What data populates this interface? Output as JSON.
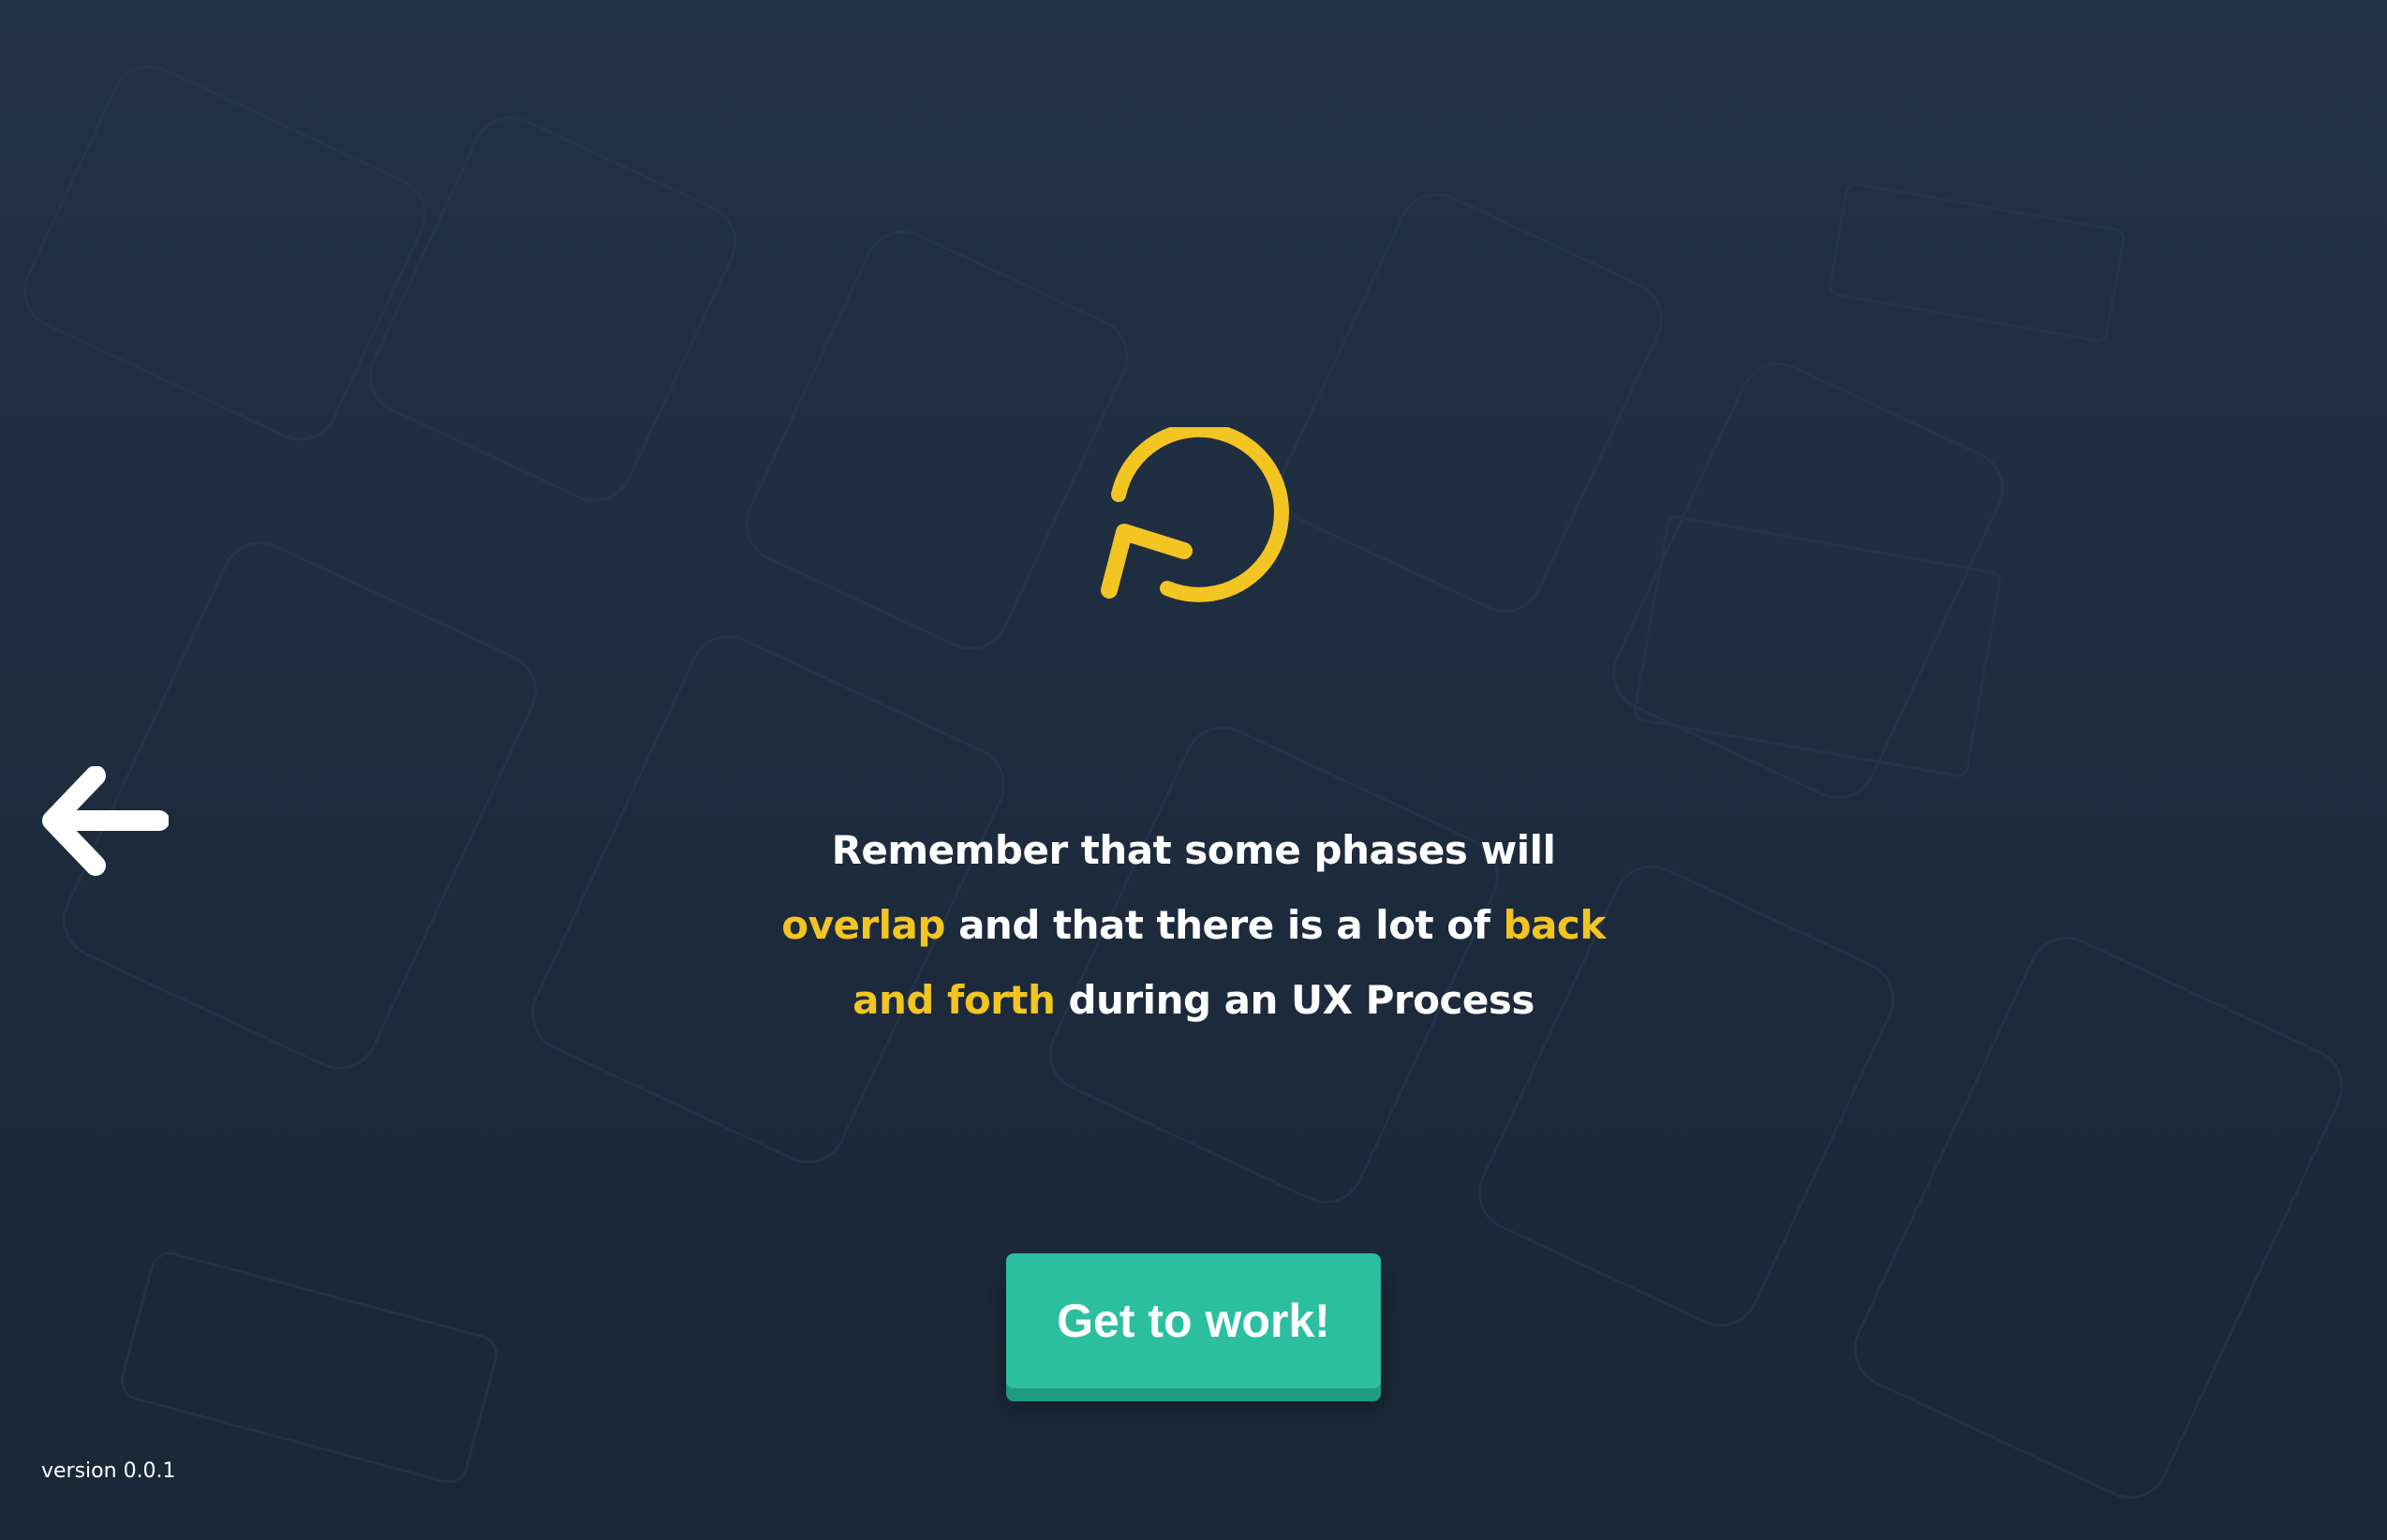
{
  "icons": {
    "back": "arrow-left-icon",
    "hero": "reload-icon"
  },
  "message": {
    "line1": "Remember that some phases will",
    "line2_hl1": "overlap",
    "line2_mid": " and that there is a lot of ",
    "line2_hl2": "back",
    "line3_hl": "and forth",
    "line3_rest": " during an UX Process"
  },
  "cta": {
    "label": "Get to work!"
  },
  "footer": {
    "version": "version 0.0.1"
  },
  "colors": {
    "accent": "#f2c522",
    "button": "#2bbf9f",
    "background": "#1f2d3f"
  }
}
